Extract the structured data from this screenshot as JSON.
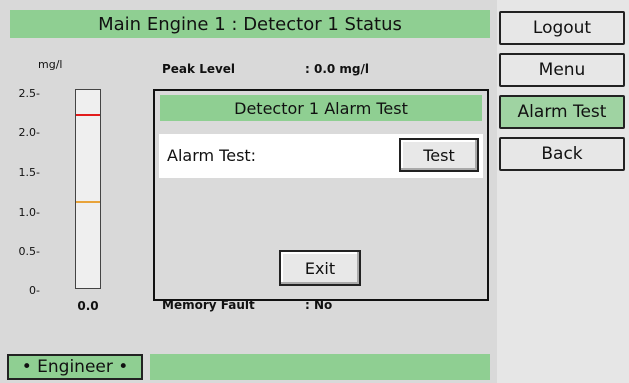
{
  "header": {
    "title": "Main Engine 1 : Detector 1 Status"
  },
  "gauge": {
    "unit": "mg/l",
    "ticks": [
      "2.5-",
      "2.0-",
      "1.5-",
      "1.0-",
      "0.5-",
      "0-"
    ],
    "reading": "0.0",
    "alarm_level": 2.2,
    "warning_level": 1.1,
    "max": 2.5,
    "colors": {
      "alarm": "#e21b1b",
      "warning": "#e8a33a"
    }
  },
  "info": {
    "rows": [
      {
        "label": "Peak Level",
        "value": ": 0.0 mg/l"
      },
      {
        "label": "Memory Fault",
        "value": ": No"
      }
    ]
  },
  "footer": {
    "mode": "• Engineer •"
  },
  "sidebar": {
    "buttons": [
      {
        "label": "Logout"
      },
      {
        "label": "Menu"
      },
      {
        "label": "Alarm Test"
      },
      {
        "label": "Back"
      }
    ]
  },
  "modal": {
    "title": "Detector 1 Alarm Test",
    "row_label": "Alarm Test:",
    "test_button": "Test",
    "exit_button": "Exit"
  },
  "colors": {
    "accent": "#8fcf92",
    "active_button": "#9fd3a2"
  }
}
